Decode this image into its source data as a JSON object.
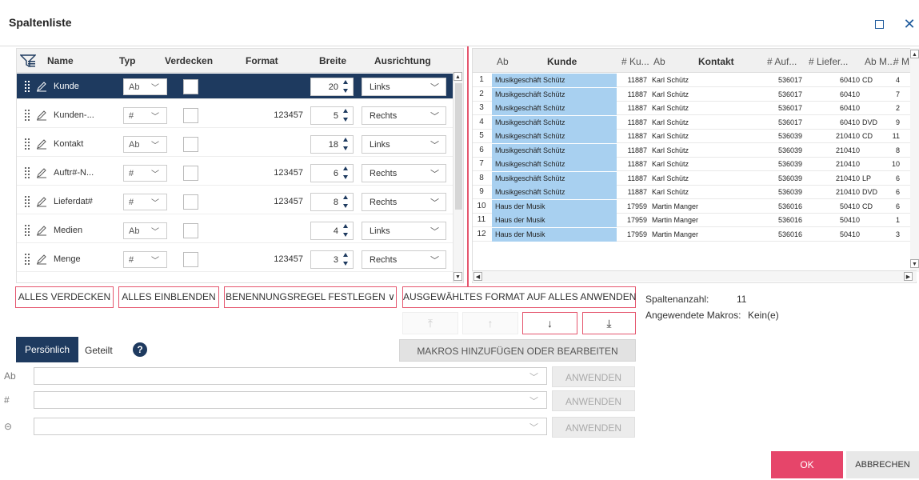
{
  "window": {
    "title": "Spaltenliste",
    "maximize_glyph": "☐",
    "close_glyph": "✕"
  },
  "left_grid": {
    "headers": {
      "name": "Name",
      "typ": "Typ",
      "verdecken": "Verdecken",
      "format": "Format",
      "breite": "Breite",
      "ausrichtung": "Ausrichtung"
    },
    "rows": [
      {
        "name": "Kunde",
        "typ": "Ab",
        "format": "",
        "breite": "20",
        "ausrichtung": "Links",
        "selected": true
      },
      {
        "name": "Kunden-...",
        "typ": "#",
        "format": "123457",
        "breite": "5",
        "ausrichtung": "Rechts",
        "selected": false
      },
      {
        "name": "Kontakt",
        "typ": "Ab",
        "format": "",
        "breite": "18",
        "ausrichtung": "Links",
        "selected": false
      },
      {
        "name": "Auftr#-N...",
        "typ": "#",
        "format": "123457",
        "breite": "6",
        "ausrichtung": "Rechts",
        "selected": false
      },
      {
        "name": "Lieferdat#",
        "typ": "#",
        "format": "123457",
        "breite": "8",
        "ausrichtung": "Rechts",
        "selected": false
      },
      {
        "name": "Medien",
        "typ": "Ab",
        "format": "",
        "breite": "4",
        "ausrichtung": "Links",
        "selected": false
      },
      {
        "name": "Menge",
        "typ": "#",
        "format": "123457",
        "breite": "3",
        "ausrichtung": "Rechts",
        "selected": false
      }
    ]
  },
  "right_grid": {
    "headers": [
      "Ab",
      "Kunde",
      "# Ku...",
      "Ab",
      "Kontakt",
      "# Auf...",
      "# Liefer...",
      "Ab M...",
      "# M"
    ],
    "rows": [
      {
        "n": "1",
        "kunde": "Musikgeschäft Schütz",
        "kunr": "11887",
        "kontakt": "Karl Schütz",
        "auftr": "536017",
        "liefer": "60410",
        "medien": "CD",
        "menge": "4"
      },
      {
        "n": "2",
        "kunde": "Musikgeschäft Schütz",
        "kunr": "11887",
        "kontakt": "Karl Schütz",
        "auftr": "536017",
        "liefer": "60410",
        "medien": "",
        "menge": "7"
      },
      {
        "n": "3",
        "kunde": "Musikgeschäft Schütz",
        "kunr": "11887",
        "kontakt": "Karl Schütz",
        "auftr": "536017",
        "liefer": "60410",
        "medien": "",
        "menge": "2"
      },
      {
        "n": "4",
        "kunde": "Musikgeschäft Schütz",
        "kunr": "11887",
        "kontakt": "Karl Schütz",
        "auftr": "536017",
        "liefer": "60410",
        "medien": "DVD",
        "menge": "9"
      },
      {
        "n": "5",
        "kunde": "Musikgeschäft Schütz",
        "kunr": "11887",
        "kontakt": "Karl Schütz",
        "auftr": "536039",
        "liefer": "210410",
        "medien": "CD",
        "menge": "11"
      },
      {
        "n": "6",
        "kunde": "Musikgeschäft Schütz",
        "kunr": "11887",
        "kontakt": "Karl Schütz",
        "auftr": "536039",
        "liefer": "210410",
        "medien": "",
        "menge": "8"
      },
      {
        "n": "7",
        "kunde": "Musikgeschäft Schütz",
        "kunr": "11887",
        "kontakt": "Karl Schütz",
        "auftr": "536039",
        "liefer": "210410",
        "medien": "",
        "menge": "10"
      },
      {
        "n": "8",
        "kunde": "Musikgeschäft Schütz",
        "kunr": "11887",
        "kontakt": "Karl Schütz",
        "auftr": "536039",
        "liefer": "210410",
        "medien": "LP",
        "menge": "6"
      },
      {
        "n": "9",
        "kunde": "Musikgeschäft Schütz",
        "kunr": "11887",
        "kontakt": "Karl Schütz",
        "auftr": "536039",
        "liefer": "210410",
        "medien": "DVD",
        "menge": "6"
      },
      {
        "n": "10",
        "kunde": "Haus der Musik",
        "kunr": "17959",
        "kontakt": "Martin Manger",
        "auftr": "536016",
        "liefer": "50410",
        "medien": "CD",
        "menge": "6"
      },
      {
        "n": "11",
        "kunde": "Haus der Musik",
        "kunr": "17959",
        "kontakt": "Martin Manger",
        "auftr": "536016",
        "liefer": "50410",
        "medien": "",
        "menge": "1"
      },
      {
        "n": "12",
        "kunde": "Haus der Musik",
        "kunr": "17959",
        "kontakt": "Martin Manger",
        "auftr": "536016",
        "liefer": "50410",
        "medien": "",
        "menge": "3"
      }
    ]
  },
  "actions": {
    "alles_verdecken": "ALLES VERDECKEN",
    "alles_einblenden": "ALLES EINBLENDEN",
    "benennungsregel": "BENENNUNGSREGEL FESTLEGEN ∨",
    "format_anwenden": "AUSGEWÄHLTES FORMAT AUF ALLES ANWENDEN",
    "makros": "MAKROS HINZUFÜGEN ODER BEARBEITEN"
  },
  "info": {
    "spaltenanzahl_label": "Spaltenanzahl:",
    "spaltenanzahl_value": "11",
    "makros_label": "Angewendete Makros:",
    "makros_value": "Kein(e)"
  },
  "tabs": {
    "persoenlich": "Persönlich",
    "geteilt": "Geteilt",
    "help": "?"
  },
  "rules": [
    {
      "type_label": "Ab",
      "apply": "ANWENDEN"
    },
    {
      "type_label": "#",
      "apply": "ANWENDEN"
    },
    {
      "type_label": "⊝",
      "apply": "ANWENDEN"
    }
  ],
  "footer": {
    "ok": "OK",
    "cancel": "ABBRECHEN"
  },
  "colors": {
    "accent": "#e6456a",
    "selected": "#1e3a5f",
    "highlight": "#a8d0f0"
  }
}
